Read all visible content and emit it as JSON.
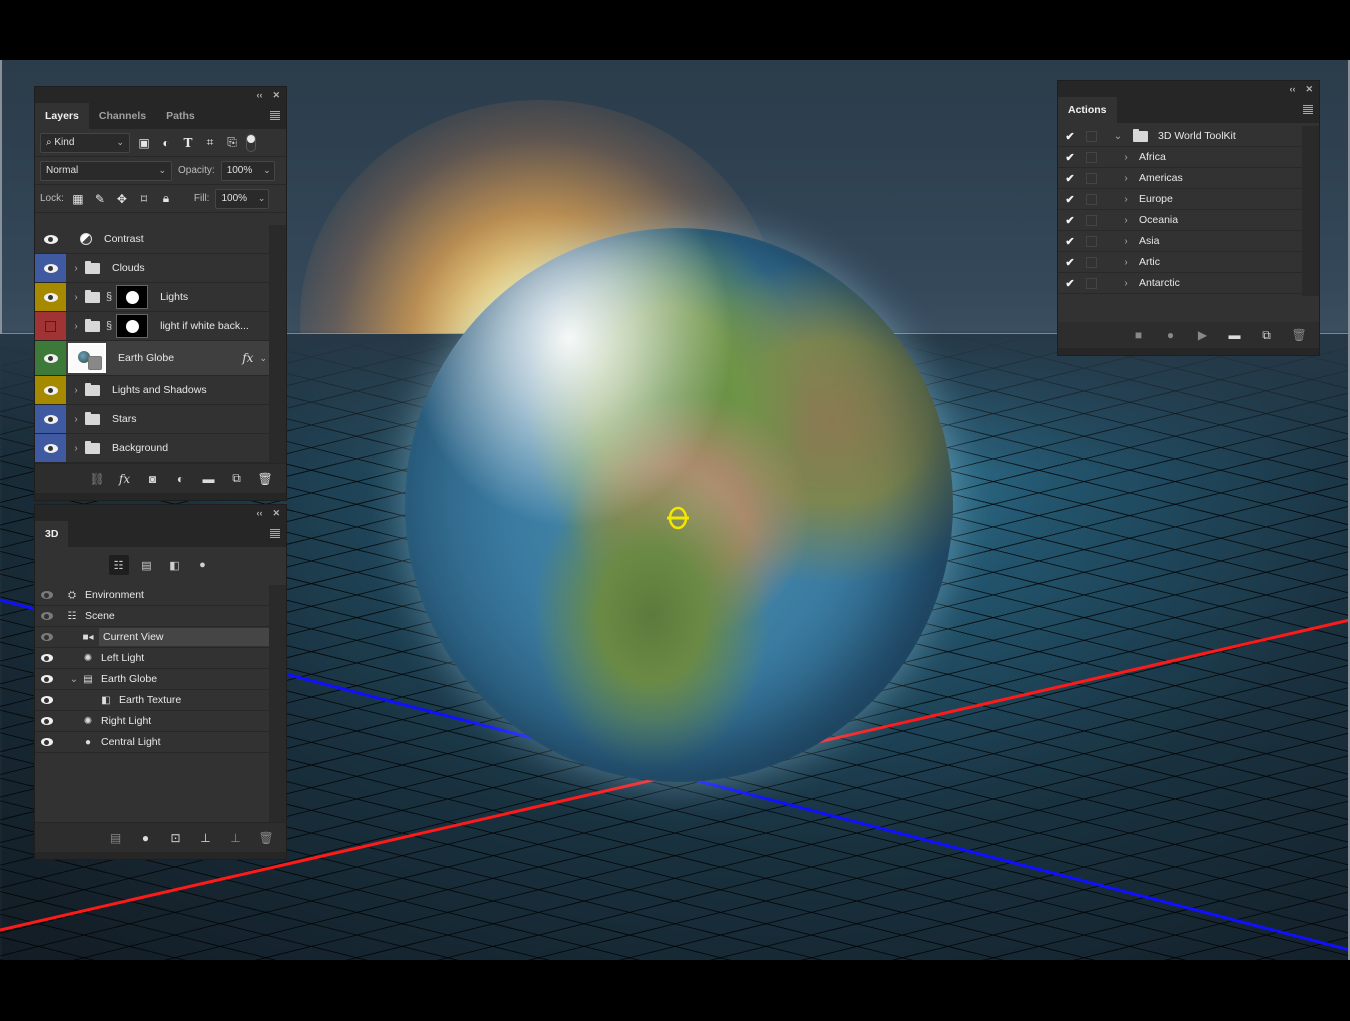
{
  "colors": {
    "axis_x": "#ff1a1a",
    "axis_z": "#1010ff",
    "widget": "#f5e600",
    "tag_blue": "#3f5aa0",
    "tag_yellow": "#a58a00",
    "tag_red": "#a03434",
    "tag_green": "#3d7a3a"
  },
  "layers_panel": {
    "tabs": [
      {
        "label": "Layers",
        "active": true
      },
      {
        "label": "Channels",
        "active": false
      },
      {
        "label": "Paths",
        "active": false
      }
    ],
    "filter": {
      "label": "Kind"
    },
    "blend_mode": "Normal",
    "opacity_label": "Opacity:",
    "opacity_value": "100%",
    "lock_label": "Lock:",
    "fill_label": "Fill:",
    "fill_value": "100%",
    "layers": [
      {
        "name": "Contrast",
        "type": "adjustment",
        "visible": true,
        "tag": "none"
      },
      {
        "name": "Clouds",
        "type": "group",
        "visible": true,
        "tag": "blue"
      },
      {
        "name": "Lights",
        "type": "group-mask",
        "visible": true,
        "tag": "yellow"
      },
      {
        "name": "light if white back...",
        "type": "group-mask",
        "visible": false,
        "tag": "red"
      },
      {
        "name": "Earth Globe",
        "type": "3d-smart",
        "visible": true,
        "tag": "green",
        "has_fx": true
      },
      {
        "name": "Lights and Shadows",
        "type": "group",
        "visible": true,
        "tag": "yellow"
      },
      {
        "name": "Stars",
        "type": "group",
        "visible": true,
        "tag": "blue"
      },
      {
        "name": "Background",
        "type": "group",
        "visible": true,
        "tag": "blue"
      }
    ]
  },
  "three_d_panel": {
    "tab": "3D",
    "scene_items": [
      {
        "name": "Environment",
        "icon": "environment-icon",
        "indent": 0,
        "visible": "dim"
      },
      {
        "name": "Scene",
        "icon": "scene-icon",
        "indent": 0,
        "visible": "dim"
      },
      {
        "name": "Current View",
        "icon": "camera-icon",
        "indent": 1,
        "visible": "dim",
        "selected": true
      },
      {
        "name": "Left Light",
        "icon": "infinite-light-icon",
        "indent": 1,
        "visible": "on"
      },
      {
        "name": "Earth Globe",
        "icon": "mesh-icon",
        "indent": 1,
        "visible": "on",
        "expanded": true
      },
      {
        "name": "Earth Texture",
        "icon": "material-icon",
        "indent": 2,
        "visible": "on"
      },
      {
        "name": "Right Light",
        "icon": "infinite-light-icon",
        "indent": 1,
        "visible": "on"
      },
      {
        "name": "Central Light",
        "icon": "point-light-icon",
        "indent": 1,
        "visible": "on"
      }
    ]
  },
  "actions_panel": {
    "tab": "Actions",
    "set": {
      "name": "3D World ToolKit",
      "checked": true,
      "expanded": true
    },
    "actions": [
      {
        "name": "Africa",
        "checked": true
      },
      {
        "name": "Americas",
        "checked": true
      },
      {
        "name": "Europe",
        "checked": true
      },
      {
        "name": "Oceania",
        "checked": true
      },
      {
        "name": "Asia",
        "checked": true
      },
      {
        "name": "Artic",
        "checked": true
      },
      {
        "name": "Antarctic",
        "checked": true
      }
    ]
  }
}
